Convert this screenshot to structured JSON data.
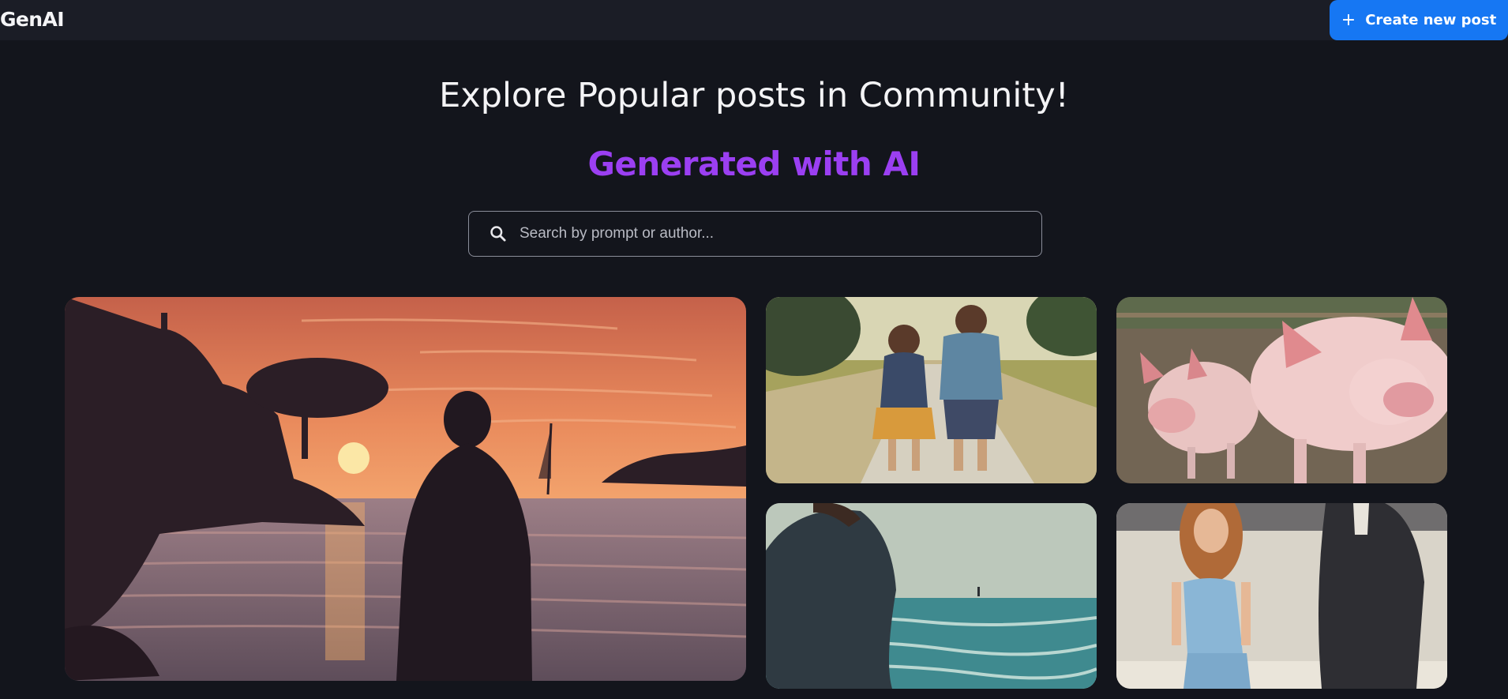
{
  "navbar": {
    "logo": "GenAI",
    "create_button_label": "Create new post",
    "create_button_icon": "plus-icon"
  },
  "hero": {
    "title": "Explore Popular posts in Community!",
    "subtitle": "Generated with AI"
  },
  "search": {
    "icon": "search-icon",
    "placeholder": "Search by prompt or author...",
    "value": ""
  },
  "colors": {
    "background": "#13151c",
    "navbar": "#1b1d26",
    "accent_blue": "#1677f3",
    "accent_purple": "#9b3ff2"
  },
  "posts": [
    {
      "image": "silhouette-man-at-sunset-by-sea"
    },
    {
      "image": "two-children-walking-on-path"
    },
    {
      "image": "two-pigs-in-farm-pen"
    },
    {
      "image": "man-looking-at-stormy-sea"
    },
    {
      "image": "woman-in-blue-dress-and-man-in-suit"
    }
  ]
}
